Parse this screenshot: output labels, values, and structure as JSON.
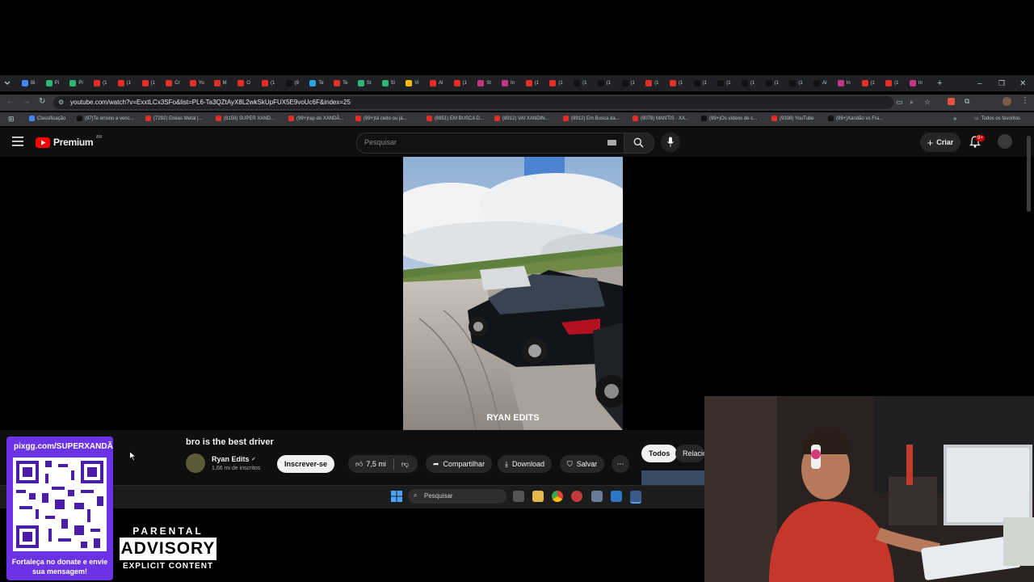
{
  "browser": {
    "url": "youtube.com/watch?v=ExxtLCx3SFo&list=PL6-Ta3QZtAyX8L2wkSkUpFUX5E9voUc6F&index=25",
    "tabs": [
      "Bi",
      "Pi",
      "Pi",
      "(1",
      "(1",
      "(1",
      "Cr",
      "Yo",
      "M",
      "O",
      "(1",
      "(9",
      "Te",
      "Te",
      "St",
      "Sl",
      "Vi",
      "Al",
      "(1",
      "St",
      "In",
      "(1",
      "(1",
      "(1",
      "(1",
      "(1",
      "(1",
      "(1",
      "(1",
      "(1",
      "(1",
      "(1",
      "(1",
      "Al",
      "In",
      "(1",
      "(1",
      "In"
    ],
    "bookmarks": [
      "Classificação",
      "(97)Te ensino a venc...",
      "(7292) Enéas Metal |...",
      "(8159) SUPER XAND...",
      "(99+)rap do XANDÃ...",
      "(99+)tá cedo ou já...",
      "(8851) EM BUSCA D...",
      "(8912) VAI XANDIN...",
      "(8912) Em Busca da...",
      "(9078) MANTIS · XA...",
      "(99+)Os vídeos de c...",
      "(9338) YouTube",
      "(99+)Xandão vs Fra..."
    ],
    "all_bookmarks": "Todos os favoritos"
  },
  "youtube": {
    "logo_text": "Premium",
    "logo_region": "BR",
    "search_placeholder": "Pesquisar",
    "create_label": "Criar",
    "notification_count": "9+",
    "video_overlay_text": "RYAN EDITS",
    "video_title": "bro is the best driver",
    "channel_name": "Ryan Edits",
    "subscribers": "1,66 mi de inscritos",
    "subscribe_label": "Inscrever-se",
    "likes": "7,5 mi",
    "share_label": "Compartilhar",
    "download_label": "Download",
    "save_label": "Salvar",
    "chips": [
      "Todos",
      "Relacio"
    ]
  },
  "taskbar": {
    "search_placeholder": "Pesquisar"
  },
  "overlay": {
    "donate_url": "pixgg.com/SUPERXANDÃ",
    "donate_caption": "Fortaleça no donate e envie sua mensagem!",
    "advisory_top": "PARENTAL",
    "advisory_mid": "ADVISORY",
    "advisory_bottom": "EXPLICIT CONTENT"
  },
  "colors": {
    "yt_red": "#ff0000",
    "donate_purple": "#6c33e6",
    "chrome_dark": "#202124"
  }
}
